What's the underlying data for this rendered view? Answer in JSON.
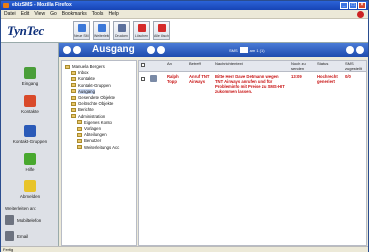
{
  "window": {
    "title": "ebizSMS - Mozilla Firefox"
  },
  "menu": [
    "Datei",
    "Edit",
    "View",
    "Go",
    "Bookmarks",
    "Tools",
    "Help"
  ],
  "app": {
    "logo": "TynTec"
  },
  "toolbar": [
    {
      "label": "Neue SMS",
      "icon": "new-sms-icon",
      "color": "#3c78d8"
    },
    {
      "label": "Weiterleiten",
      "icon": "forward-icon",
      "color": "#3c78d8"
    },
    {
      "label": "Drucken",
      "icon": "print-icon",
      "color": "#5a6f9c"
    },
    {
      "label": "Löschen",
      "icon": "delete-icon",
      "color": "#d52b2b"
    },
    {
      "label": "Alle löschen",
      "icon": "delete-all-icon",
      "color": "#d52b2b"
    }
  ],
  "section": {
    "title": "Ausgang",
    "pager_label": "SMS",
    "pager_text": "am 1 (1)"
  },
  "sidebar": {
    "buttons": [
      {
        "label": "Eingang",
        "icon": "inbox-icon",
        "color": "#4a9e3a"
      },
      {
        "label": "Kontakte",
        "icon": "contacts-icon",
        "color": "#d94a2a"
      },
      {
        "label": "Kontakt-Gruppen",
        "icon": "contact-groups-icon",
        "color": "#2a5ab8"
      },
      {
        "label": "Hilfe",
        "icon": "help-icon",
        "color": "#48a82e"
      },
      {
        "label": "Abmelden",
        "icon": "logout-icon",
        "color": "#e8c42a"
      }
    ],
    "footer_heading": "Weiterleiten an:",
    "footer": [
      {
        "label": "Mobiltelefon",
        "icon": "mobile-phone-icon"
      },
      {
        "label": "Email",
        "icon": "email-icon"
      }
    ]
  },
  "tree": [
    {
      "label": "Manuela Bergers",
      "indent": 0,
      "selected": false
    },
    {
      "label": "Inbox",
      "indent": 1,
      "selected": false
    },
    {
      "label": "Kontakte",
      "indent": 1,
      "selected": false
    },
    {
      "label": "Kontakt-Gruppen",
      "indent": 1,
      "selected": false
    },
    {
      "label": "Ausgang",
      "indent": 1,
      "selected": true
    },
    {
      "label": "Gesendete Objekte",
      "indent": 1,
      "selected": false
    },
    {
      "label": "Gelöschte Objekte",
      "indent": 1,
      "selected": false
    },
    {
      "label": "Berichte",
      "indent": 1,
      "selected": false
    },
    {
      "label": "Administration",
      "indent": 1,
      "selected": false
    },
    {
      "label": "Eigenes Konto",
      "indent": 2,
      "selected": false
    },
    {
      "label": "Vorlagen",
      "indent": 2,
      "selected": false
    },
    {
      "label": "Abteilungen",
      "indent": 2,
      "selected": false
    },
    {
      "label": "Benutzer",
      "indent": 2,
      "selected": false
    },
    {
      "label": "Weiterleitungs Acc",
      "indent": 2,
      "selected": false
    }
  ],
  "table": {
    "columns": [
      "",
      "",
      "An",
      "Betreff",
      "Nachrichtentext",
      "Noch zu senden",
      "Status",
      "SMS zugestellt"
    ],
    "rows": [
      {
        "to": "Ralph Topp",
        "subject": "Anruf TNT Airways",
        "message": "Bitte Herr Dave Detmann wegen TNT Airways anrufen und für Probleminfo mit Preise zu SMS-HIT zukommen lassen.",
        "pending": "13:09",
        "status": "Hochrecht generiert",
        "delivered": "0/0"
      }
    ]
  },
  "status": {
    "text": "Fertig"
  }
}
